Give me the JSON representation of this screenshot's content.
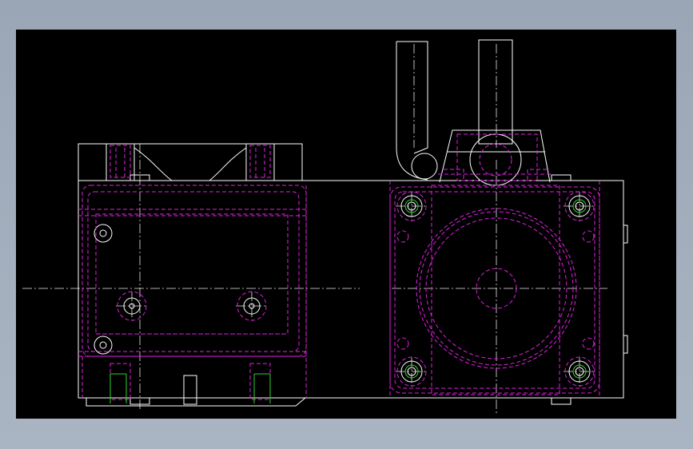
{
  "viewport": {
    "background": "#000000"
  },
  "colors": {
    "outline": "#ffffff",
    "hidden": "#e020e0",
    "center": "#e8e8e8",
    "thread": "#30d030"
  },
  "line_styles": {
    "outline": "solid",
    "hidden": "dashed",
    "center": "dash-dot"
  }
}
